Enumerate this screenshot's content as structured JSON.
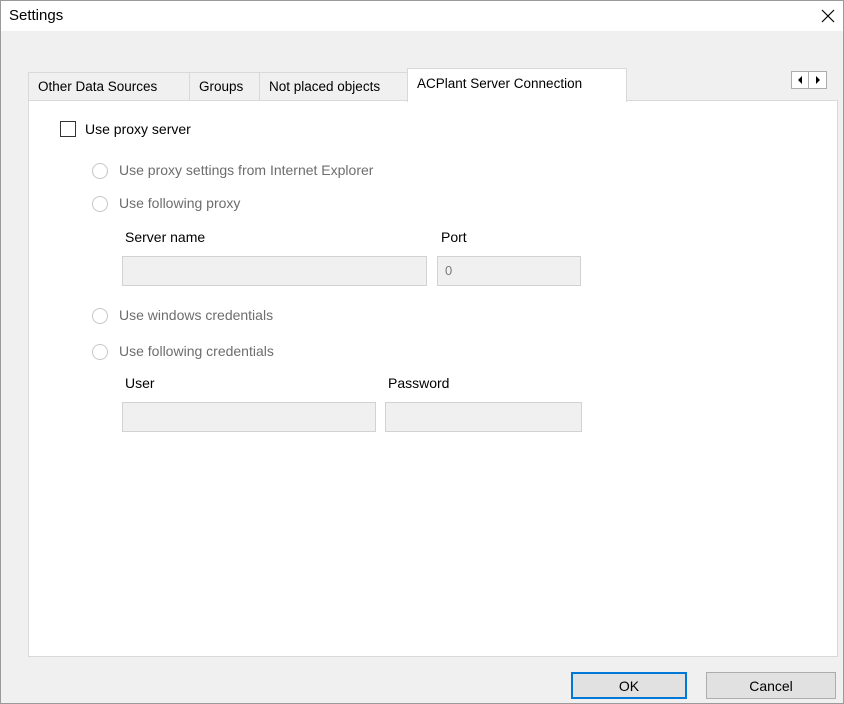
{
  "window": {
    "title": "Settings",
    "close_icon": "close-icon"
  },
  "tabs": [
    {
      "label": "Other Data Sources",
      "active": false
    },
    {
      "label": "Groups",
      "active": false
    },
    {
      "label": "Not placed objects",
      "active": false
    },
    {
      "label": "ACPlant Server Connection",
      "active": true
    }
  ],
  "tab_scroll": {
    "left_icon": "arrow-left-icon",
    "right_icon": "arrow-right-icon"
  },
  "proxy": {
    "use_proxy_label": "Use proxy server",
    "use_proxy_checked": false,
    "ie_settings_label": "Use proxy settings from Internet Explorer",
    "following_proxy_label": "Use following proxy",
    "server_name_label": "Server name",
    "server_name_value": "",
    "port_label": "Port",
    "port_value": "0"
  },
  "credentials": {
    "windows_label": "Use windows credentials",
    "following_label": "Use following credentials",
    "user_label": "User",
    "user_value": "",
    "password_label": "Password",
    "password_value": ""
  },
  "buttons": {
    "ok": "OK",
    "cancel": "Cancel"
  }
}
